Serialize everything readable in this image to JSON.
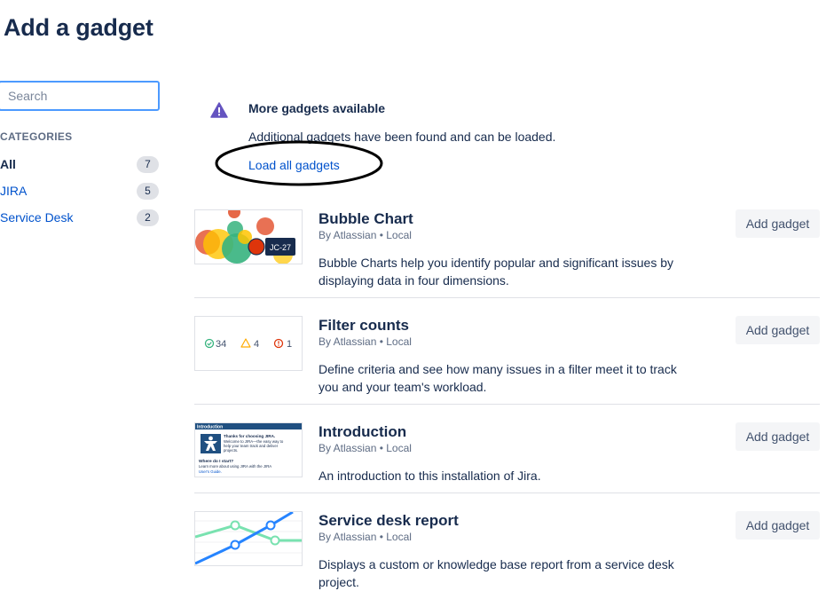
{
  "page": {
    "title": "Add a gadget"
  },
  "search": {
    "placeholder": "Search",
    "value": ""
  },
  "categories": {
    "heading": "CATEGORIES",
    "items": [
      {
        "label": "All",
        "count": "7",
        "active": true
      },
      {
        "label": "JIRA",
        "count": "5",
        "active": false
      },
      {
        "label": "Service Desk",
        "count": "2",
        "active": false
      }
    ]
  },
  "notice": {
    "icon": "warning-icon",
    "title": "More gadgets available",
    "text": "Additional gadgets have been found and can be loaded.",
    "link": "Load all gadgets"
  },
  "gadgets": [
    {
      "title": "Bubble Chart",
      "author": "By Atlassian • Local",
      "description": "Bubble Charts help you identify popular and significant issues by displaying data in four dimensions.",
      "button": "Add gadget",
      "thumb": {
        "tooltip": "JC-27"
      }
    },
    {
      "title": "Filter counts",
      "author": "By Atlassian • Local",
      "description": "Define criteria and see how many issues in a filter meet it to track you and your team's workload.",
      "button": "Add gadget",
      "thumb": {
        "count_ok": "34",
        "count_warn": "4",
        "count_err": "1"
      }
    },
    {
      "title": "Introduction",
      "author": "By Atlassian • Local",
      "description": "An introduction to this installation of Jira.",
      "button": "Add gadget",
      "thumb": {
        "header": "Introduction",
        "heading": "Thanks for choosing JIRA.",
        "line1": "Welcome to JIRA—the easy way to",
        "line2": "help your team track and deliver",
        "line3": "projects.",
        "subheading": "Where do I start?",
        "line4": "Learn more about using JIRA with the JIRA",
        "line5": "User's Guide."
      }
    },
    {
      "title": "Service desk report",
      "author": "By Atlassian • Local",
      "description": "Displays a custom or knowledge base report from a service desk project.",
      "button": "Add gadget"
    }
  ],
  "colors": {
    "link": "#0052cc",
    "text": "#172b4d",
    "focus": "#4c9aff",
    "warning": "#6554c0"
  }
}
